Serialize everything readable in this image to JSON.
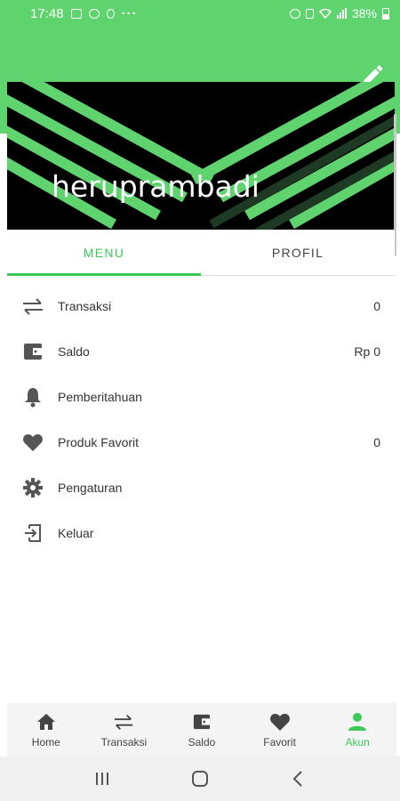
{
  "status_bar": {
    "time": "17:48",
    "battery_text": "38%",
    "more": "···",
    "left_icons": [
      "image-icon",
      "whatsapp-icon",
      "notification-icon"
    ],
    "right_icons": [
      "alarm-icon",
      "mute-icon",
      "wifi-icon",
      "signal-icon",
      "battery-icon"
    ]
  },
  "header": {
    "username": "heruprambadi",
    "edit_icon": "pencil-icon",
    "accent_color": "#5fd36e",
    "banner_color": "#000000"
  },
  "tabs": [
    {
      "label": "MENU",
      "active": true
    },
    {
      "label": "PROFIL",
      "active": false
    }
  ],
  "menu": {
    "items": [
      {
        "icon": "transfer-arrows-icon",
        "label": "Transaksi",
        "value": "0"
      },
      {
        "icon": "wallet-icon",
        "label": "Saldo",
        "value": "Rp 0"
      },
      {
        "icon": "bell-icon",
        "label": "Pemberitahuan",
        "value": ""
      },
      {
        "icon": "heart-icon",
        "label": "Produk Favorit",
        "value": "0"
      },
      {
        "icon": "gear-icon",
        "label": "Pengaturan",
        "value": ""
      },
      {
        "icon": "logout-icon",
        "label": "Keluar",
        "value": ""
      }
    ]
  },
  "bottom_nav": {
    "items": [
      {
        "icon": "home-icon",
        "label": "Home",
        "active": false
      },
      {
        "icon": "transfer-arrows-icon",
        "label": "Transaksi",
        "active": false
      },
      {
        "icon": "wallet-icon",
        "label": "Saldo",
        "active": false
      },
      {
        "icon": "heart-icon",
        "label": "Favorit",
        "active": false
      },
      {
        "icon": "person-icon",
        "label": "Akun",
        "active": true
      }
    ],
    "active_color": "#3ec85a"
  },
  "system_nav": {
    "buttons": [
      "recents-icon",
      "home-circle-icon",
      "back-icon"
    ]
  }
}
